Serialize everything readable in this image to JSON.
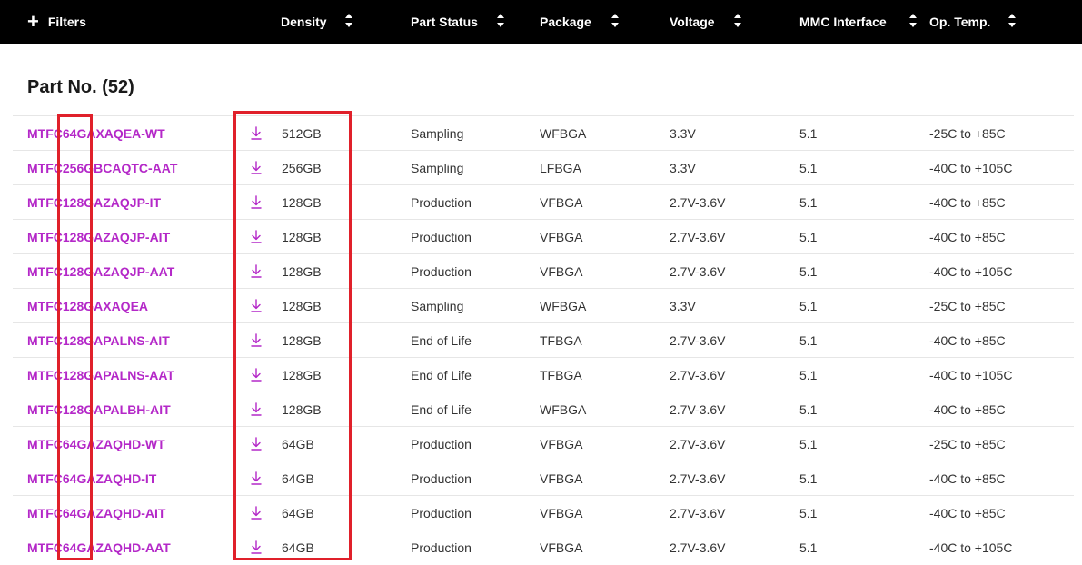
{
  "filters": {
    "label": "Filters",
    "plus_glyph": "+",
    "columns": [
      "Density",
      "Part Status",
      "Package",
      "Voltage",
      "MMC Interface",
      "Op. Temp."
    ]
  },
  "table": {
    "title": "Part No. (52)",
    "rows": [
      [
        "MTFC64GAXAQEA-WT",
        "512GB",
        "Sampling",
        "WFBGA",
        "3.3V",
        "5.1",
        "-25C to +85C"
      ],
      [
        "MTFC256GBCAQTC-AAT",
        "256GB",
        "Sampling",
        "LFBGA",
        "3.3V",
        "5.1",
        "-40C to +105C"
      ],
      [
        "MTFC128GAZAQJP-IT",
        "128GB",
        "Production",
        "VFBGA",
        "2.7V-3.6V",
        "5.1",
        "-40C to +85C"
      ],
      [
        "MTFC128GAZAQJP-AIT",
        "128GB",
        "Production",
        "VFBGA",
        "2.7V-3.6V",
        "5.1",
        "-40C to +85C"
      ],
      [
        "MTFC128GAZAQJP-AAT",
        "128GB",
        "Production",
        "VFBGA",
        "2.7V-3.6V",
        "5.1",
        "-40C to +105C"
      ],
      [
        "MTFC128GAXAQEA",
        "128GB",
        "Sampling",
        "WFBGA",
        "3.3V",
        "5.1",
        "-25C to +85C"
      ],
      [
        "MTFC128GAPALNS-AIT",
        "128GB",
        "End of Life",
        "TFBGA",
        "2.7V-3.6V",
        "5.1",
        "-40C to +85C"
      ],
      [
        "MTFC128GAPALNS-AAT",
        "128GB",
        "End of Life",
        "TFBGA",
        "2.7V-3.6V",
        "5.1",
        "-40C to +105C"
      ],
      [
        "MTFC128GAPALBH-AIT",
        "128GB",
        "End of Life",
        "WFBGA",
        "2.7V-3.6V",
        "5.1",
        "-40C to +85C"
      ],
      [
        "MTFC64GAZAQHD-WT",
        "64GB",
        "Production",
        "VFBGA",
        "2.7V-3.6V",
        "5.1",
        "-25C to +85C"
      ],
      [
        "MTFC64GAZAQHD-IT",
        "64GB",
        "Production",
        "VFBGA",
        "2.7V-3.6V",
        "5.1",
        "-40C to +85C"
      ],
      [
        "MTFC64GAZAQHD-AIT",
        "64GB",
        "Production",
        "VFBGA",
        "2.7V-3.6V",
        "5.1",
        "-40C to +85C"
      ],
      [
        "MTFC64GAZAQHD-AAT",
        "64GB",
        "Production",
        "VFBGA",
        "2.7V-3.6V",
        "5.1",
        "-40C to +105C"
      ]
    ]
  },
  "icons": {
    "download": "download-icon",
    "sort": "sort-icon"
  },
  "colors": {
    "part_link": "#b428c8",
    "header_bg": "#000000",
    "highlight_box": "#e0202a"
  }
}
